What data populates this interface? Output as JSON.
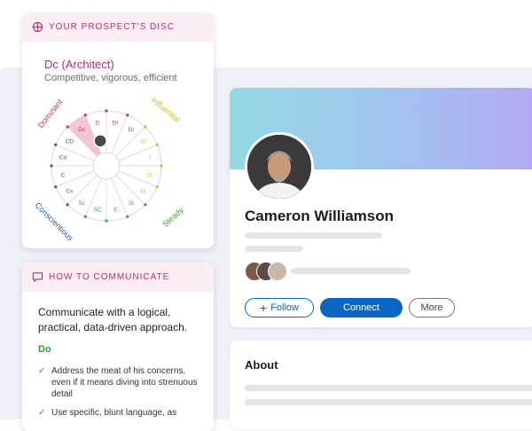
{
  "disc_card": {
    "header": "YOUR PROSPECT'S DISC",
    "type": "Dc (Architect)",
    "description": "Competitive, vigorous, efficient",
    "quadrants": {
      "dominant": "Dominant",
      "influential": "Influential",
      "steady": "Steady",
      "conscientious": "Conscientious"
    },
    "segments": [
      "DI",
      "Di",
      "iD",
      "I",
      "iS",
      "IS",
      "Si",
      "S",
      "SC",
      "Sc",
      "Cs",
      "C",
      "Cd",
      "CD",
      "Dc",
      "D"
    ],
    "highlighted_segment": "Dc",
    "colors": {
      "dominant": "#c73b3b",
      "influential": "#d9b81f",
      "steady": "#3d9f40",
      "conscientious": "#2c5e9e",
      "highlight": "#f4c6d5",
      "accent": "#b0306f"
    }
  },
  "comm_card": {
    "header": "HOW TO COMMUNICATE",
    "summary": "Communicate with a logical, practical, data-driven approach.",
    "do_label": "Do",
    "do_items": [
      "Address the meat of his concerns, even if it means diving into strenuous detail",
      "Use specific, blunt language, as"
    ]
  },
  "profile": {
    "name": "Cameron Williamson",
    "follow_label": "Follow",
    "connect_label": "Connect",
    "more_label": "More"
  },
  "about": {
    "title": "About"
  }
}
